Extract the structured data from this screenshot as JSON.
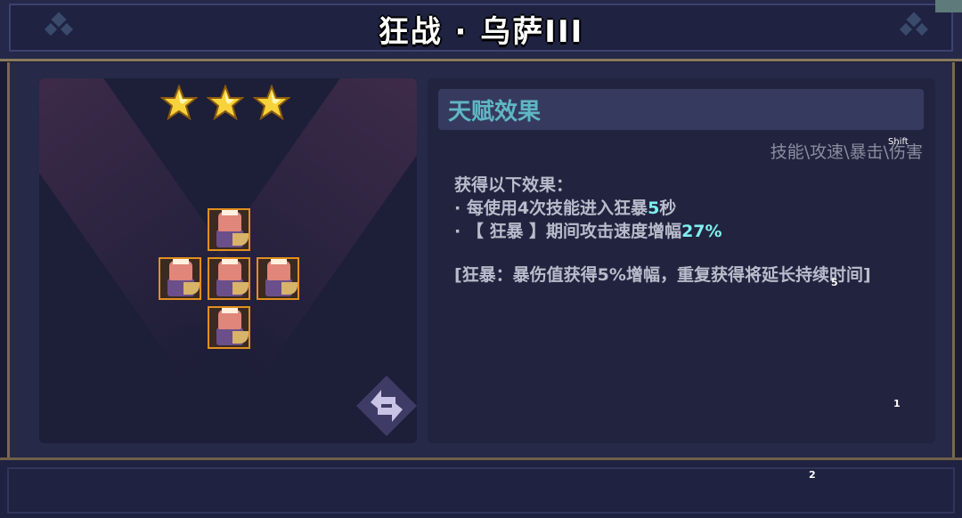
{
  "header": {
    "title": "狂战 · 乌萨III"
  },
  "hero": {
    "star_count": 3
  },
  "talent": {
    "section_title": "天赋效果",
    "tags": "技能\\攻速\\暴击\\伤害",
    "intro": "获得以下效果：",
    "line1_prefix": "· 每使用4次技能进入狂暴",
    "line1_value": "5",
    "line1_suffix": "秒",
    "line2_prefix": "· 【 狂暴 】期间攻击速度增幅",
    "line2_value": "27%",
    "note": "[狂暴：暴伤值获得5%增幅，重复获得将延长持续时间]"
  },
  "overlay_labels": {
    "shift": "Shift",
    "m5": "5",
    "m1": "1",
    "m2": "2"
  },
  "colors": {
    "accent": "#60b6c4",
    "highlight": "#7ef0ef",
    "unit_border": "#e28f1f"
  },
  "icons": [
    "star-icon",
    "swap-icon",
    "corner-ornament-icon"
  ]
}
